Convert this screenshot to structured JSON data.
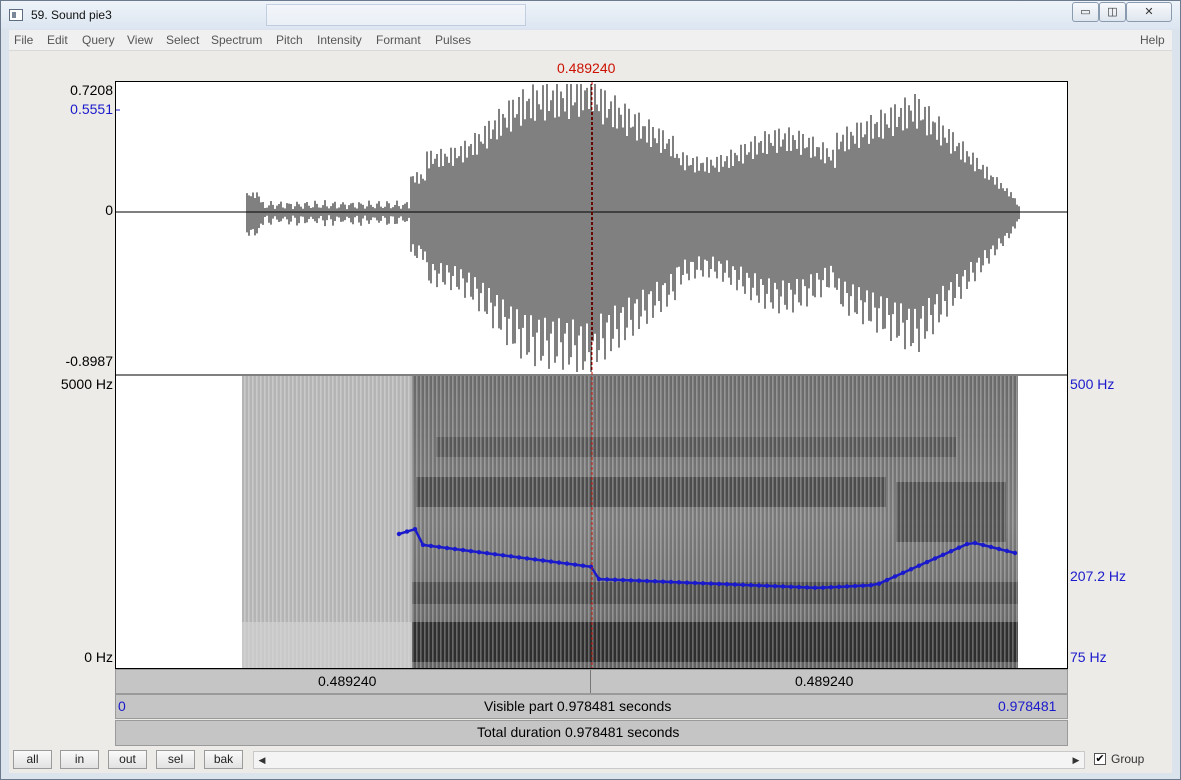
{
  "window": {
    "title": "59. Sound pie3",
    "min_label": "▭",
    "max_label": "◫",
    "close_label": "✕"
  },
  "menu": [
    "File",
    "Edit",
    "Query",
    "View",
    "Select",
    "Spectrum",
    "Pitch",
    "Intensity",
    "Formant",
    "Pulses"
  ],
  "help_label": "Help",
  "cursor_time": "0.489240",
  "waveform": {
    "max_label": "0.7208",
    "view_label": "0.5551",
    "zero_label": "0",
    "min_label": "-0.8987"
  },
  "spectrogram": {
    "top_label": "5000 Hz",
    "bottom_label": "0 Hz"
  },
  "pitch": {
    "top_label": "500 Hz",
    "mid_label": "207.2 Hz",
    "bottom_label": "75 Hz"
  },
  "time_bar": {
    "left": "0.489240",
    "right": "0.489240"
  },
  "visible_bar": {
    "start": "0",
    "label": "Visible part 0.978481 seconds",
    "end": "0.978481"
  },
  "total_bar": {
    "label": "Total duration 0.978481 seconds"
  },
  "buttons": {
    "all": "all",
    "in": "in",
    "out": "out",
    "sel": "sel",
    "bak": "bak"
  },
  "scroll": {
    "left": "◀",
    "right": "▶"
  },
  "group": {
    "checked": true,
    "mark": "✔",
    "label": "Group"
  },
  "colors": {
    "cursor": "#cc1100",
    "pitch": "#1a1acc"
  }
}
